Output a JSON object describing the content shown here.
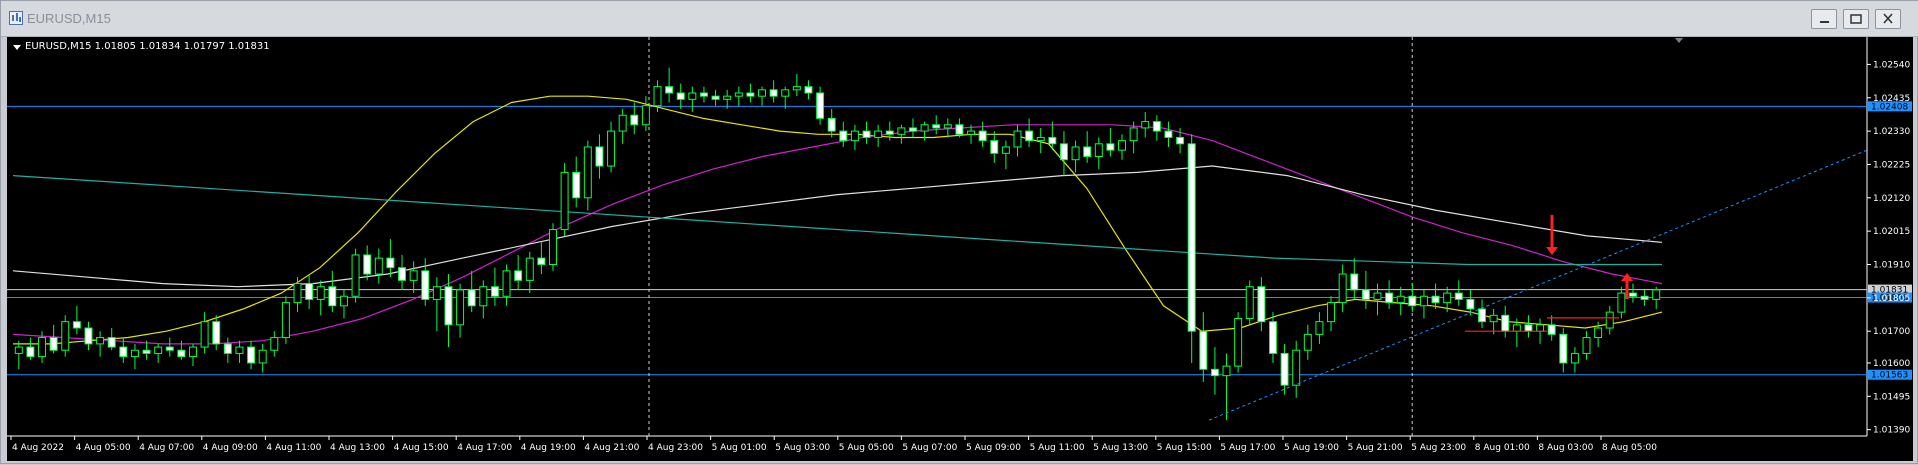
{
  "window": {
    "title": "EURUSD,M15"
  },
  "chart_data": {
    "type": "candlestick",
    "header_label": "EURUSD,M15  1.01805 1.01834 1.01797 1.01831",
    "y_ticks": [
      "1.02540",
      "1.02435",
      "1.02330",
      "1.02225",
      "1.02120",
      "1.02015",
      "1.01910",
      "1.01805",
      "1.01700",
      "1.01600",
      "1.01495",
      "1.01390"
    ],
    "x_ticks": [
      "4 Aug 2022",
      "4 Aug 05:00",
      "4 Aug 07:00",
      "4 Aug 09:00",
      "4 Aug 11:00",
      "4 Aug 13:00",
      "4 Aug 15:00",
      "4 Aug 17:00",
      "4 Aug 19:00",
      "4 Aug 21:00",
      "4 Aug 23:00",
      "5 Aug 01:00",
      "5 Aug 03:00",
      "5 Aug 05:00",
      "5 Aug 07:00",
      "5 Aug 09:00",
      "5 Aug 11:00",
      "5 Aug 13:00",
      "5 Aug 15:00",
      "5 Aug 17:00",
      "5 Aug 19:00",
      "5 Aug 21:00",
      "5 Aug 23:00",
      "8 Aug 01:00",
      "8 Aug 03:00",
      "8 Aug 05:00"
    ],
    "ylim": [
      1.0137,
      1.0262
    ],
    "horizontal_levels": [
      {
        "price": 1.02408,
        "label": "1.02408",
        "color": "#1e90ff"
      },
      {
        "price": 1.01831,
        "label": "1.01831",
        "color": "#d0d0d0"
      },
      {
        "price": 1.01806,
        "label": "1.01806",
        "color": "#1e90ff"
      },
      {
        "price": 1.01563,
        "label": "1.01563",
        "color": "#1e90ff"
      }
    ],
    "period_separators": [
      "4 Aug 23:00",
      "5 Aug 23:00"
    ],
    "candles": [
      [
        1.0163,
        1.0167,
        1.0158,
        1.0165
      ],
      [
        1.0165,
        1.0168,
        1.0161,
        1.0162
      ],
      [
        1.0162,
        1.017,
        1.016,
        1.0168
      ],
      [
        1.0168,
        1.0172,
        1.0163,
        1.0164
      ],
      [
        1.0164,
        1.0175,
        1.0162,
        1.0173
      ],
      [
        1.0173,
        1.0178,
        1.0169,
        1.0171
      ],
      [
        1.0171,
        1.0173,
        1.0164,
        1.0166
      ],
      [
        1.0166,
        1.017,
        1.0162,
        1.0168
      ],
      [
        1.0168,
        1.0171,
        1.0164,
        1.0165
      ],
      [
        1.0165,
        1.0168,
        1.016,
        1.0162
      ],
      [
        1.0162,
        1.0166,
        1.0158,
        1.0164
      ],
      [
        1.0164,
        1.0167,
        1.0161,
        1.0163
      ],
      [
        1.0163,
        1.0166,
        1.016,
        1.0165
      ],
      [
        1.0165,
        1.0168,
        1.0162,
        1.0164
      ],
      [
        1.0164,
        1.0167,
        1.0161,
        1.0162
      ],
      [
        1.0162,
        1.0166,
        1.0159,
        1.0165
      ],
      [
        1.0165,
        1.0176,
        1.0163,
        1.0173
      ],
      [
        1.0173,
        1.0175,
        1.0164,
        1.0166
      ],
      [
        1.0166,
        1.0168,
        1.016,
        1.0163
      ],
      [
        1.0163,
        1.0167,
        1.016,
        1.0165
      ],
      [
        1.0165,
        1.0167,
        1.0158,
        1.016
      ],
      [
        1.016,
        1.0166,
        1.0157,
        1.0164
      ],
      [
        1.0164,
        1.017,
        1.0162,
        1.0168
      ],
      [
        1.0168,
        1.0181,
        1.0166,
        1.0179
      ],
      [
        1.0179,
        1.0187,
        1.0176,
        1.0185
      ],
      [
        1.0185,
        1.0188,
        1.0177,
        1.018
      ],
      [
        1.018,
        1.0186,
        1.0175,
        1.0184
      ],
      [
        1.0184,
        1.0189,
        1.0176,
        1.0178
      ],
      [
        1.0178,
        1.0183,
        1.0174,
        1.0181
      ],
      [
        1.0181,
        1.0196,
        1.0179,
        1.0194
      ],
      [
        1.0194,
        1.0197,
        1.0186,
        1.0188
      ],
      [
        1.0188,
        1.0196,
        1.0185,
        1.0193
      ],
      [
        1.0193,
        1.0199,
        1.0187,
        1.019
      ],
      [
        1.019,
        1.0194,
        1.0183,
        1.0186
      ],
      [
        1.0186,
        1.0192,
        1.0182,
        1.0189
      ],
      [
        1.0189,
        1.0193,
        1.0178,
        1.018
      ],
      [
        1.018,
        1.0187,
        1.017,
        1.0184
      ],
      [
        1.0184,
        1.0188,
        1.0165,
        1.0172
      ],
      [
        1.0172,
        1.0185,
        1.0168,
        1.0183
      ],
      [
        1.0183,
        1.0189,
        1.0176,
        1.0178
      ],
      [
        1.0178,
        1.0186,
        1.0174,
        1.0184
      ],
      [
        1.0184,
        1.019,
        1.0178,
        1.0181
      ],
      [
        1.0181,
        1.0191,
        1.0178,
        1.0189
      ],
      [
        1.0189,
        1.0194,
        1.0183,
        1.0186
      ],
      [
        1.0186,
        1.0195,
        1.0182,
        1.0193
      ],
      [
        1.0193,
        1.0198,
        1.0188,
        1.0191
      ],
      [
        1.0191,
        1.0204,
        1.0189,
        1.0202
      ],
      [
        1.0202,
        1.0223,
        1.02,
        1.022
      ],
      [
        1.022,
        1.0225,
        1.0209,
        1.0212
      ],
      [
        1.0212,
        1.023,
        1.0208,
        1.0228
      ],
      [
        1.0228,
        1.0232,
        1.0218,
        1.0222
      ],
      [
        1.0222,
        1.0236,
        1.022,
        1.0233
      ],
      [
        1.0233,
        1.024,
        1.0229,
        1.0238
      ],
      [
        1.0238,
        1.0242,
        1.0232,
        1.0235
      ],
      [
        1.0235,
        1.0244,
        1.0233,
        1.0241
      ],
      [
        1.0241,
        1.0249,
        1.0239,
        1.0247
      ],
      [
        1.0247,
        1.0253,
        1.0242,
        1.0245
      ],
      [
        1.0245,
        1.0248,
        1.024,
        1.0243
      ],
      [
        1.0243,
        1.0247,
        1.0239,
        1.0245
      ],
      [
        1.0245,
        1.0247,
        1.0242,
        1.0244
      ],
      [
        1.0244,
        1.0246,
        1.0241,
        1.0243
      ],
      [
        1.0243,
        1.0246,
        1.024,
        1.0244
      ],
      [
        1.0244,
        1.0247,
        1.0241,
        1.0245
      ],
      [
        1.0245,
        1.0248,
        1.0242,
        1.0244
      ],
      [
        1.0244,
        1.0247,
        1.0241,
        1.0246
      ],
      [
        1.0246,
        1.0249,
        1.0242,
        1.0244
      ],
      [
        1.0244,
        1.0247,
        1.024,
        1.0246
      ],
      [
        1.0246,
        1.0251,
        1.0244,
        1.0247
      ],
      [
        1.0247,
        1.0249,
        1.0243,
        1.0245
      ],
      [
        1.0245,
        1.0247,
        1.0235,
        1.0237
      ],
      [
        1.0237,
        1.024,
        1.0231,
        1.0233
      ],
      [
        1.0233,
        1.0236,
        1.0228,
        1.023
      ],
      [
        1.023,
        1.0235,
        1.0227,
        1.0233
      ],
      [
        1.0233,
        1.0236,
        1.0229,
        1.0231
      ],
      [
        1.0231,
        1.0235,
        1.0228,
        1.0233
      ],
      [
        1.0233,
        1.0236,
        1.023,
        1.0232
      ],
      [
        1.0232,
        1.0235,
        1.0229,
        1.0234
      ],
      [
        1.0234,
        1.0237,
        1.0231,
        1.0233
      ],
      [
        1.0233,
        1.0236,
        1.023,
        1.0235
      ],
      [
        1.0235,
        1.0238,
        1.0232,
        1.0234
      ],
      [
        1.0234,
        1.0237,
        1.0231,
        1.0235
      ],
      [
        1.0235,
        1.0237,
        1.0231,
        1.0232
      ],
      [
        1.0232,
        1.0235,
        1.0229,
        1.0233
      ],
      [
        1.0233,
        1.0236,
        1.0228,
        1.023
      ],
      [
        1.023,
        1.0233,
        1.0223,
        1.0226
      ],
      [
        1.0226,
        1.023,
        1.0221,
        1.0228
      ],
      [
        1.0228,
        1.0235,
        1.0225,
        1.0233
      ],
      [
        1.0233,
        1.0237,
        1.0228,
        1.023
      ],
      [
        1.023,
        1.0234,
        1.0226,
        1.0231
      ],
      [
        1.0231,
        1.0236,
        1.0227,
        1.0229
      ],
      [
        1.0229,
        1.0233,
        1.0219,
        1.0224
      ],
      [
        1.0224,
        1.023,
        1.022,
        1.0228
      ],
      [
        1.0228,
        1.0233,
        1.0223,
        1.0225
      ],
      [
        1.0225,
        1.0231,
        1.0221,
        1.0229
      ],
      [
        1.0229,
        1.0234,
        1.0225,
        1.0227
      ],
      [
        1.0227,
        1.0232,
        1.0224,
        1.023
      ],
      [
        1.023,
        1.0236,
        1.0226,
        1.0234
      ],
      [
        1.0234,
        1.0239,
        1.0231,
        1.0236
      ],
      [
        1.0236,
        1.0238,
        1.023,
        1.0233
      ],
      [
        1.0233,
        1.0236,
        1.0228,
        1.0231
      ],
      [
        1.0231,
        1.0234,
        1.0226,
        1.0229
      ],
      [
        1.0229,
        1.0232,
        1.016,
        1.017
      ],
      [
        1.017,
        1.0176,
        1.0154,
        1.0158
      ],
      [
        1.0158,
        1.0165,
        1.015,
        1.0156
      ],
      [
        1.0156,
        1.0163,
        1.0142,
        1.0159
      ],
      [
        1.0159,
        1.0176,
        1.0157,
        1.0174
      ],
      [
        1.0174,
        1.0186,
        1.0172,
        1.0184
      ],
      [
        1.0184,
        1.0187,
        1.017,
        1.0173
      ],
      [
        1.0173,
        1.0176,
        1.016,
        1.0163
      ],
      [
        1.0163,
        1.0166,
        1.015,
        1.0153
      ],
      [
        1.0153,
        1.0167,
        1.0149,
        1.0164
      ],
      [
        1.0164,
        1.0172,
        1.0161,
        1.0169
      ],
      [
        1.0169,
        1.0176,
        1.0166,
        1.0173
      ],
      [
        1.0173,
        1.0181,
        1.017,
        1.0179
      ],
      [
        1.0179,
        1.0191,
        1.0176,
        1.0188
      ],
      [
        1.0188,
        1.0193,
        1.018,
        1.0183
      ],
      [
        1.0183,
        1.0189,
        1.0177,
        1.018
      ],
      [
        1.018,
        1.0185,
        1.0175,
        1.0182
      ],
      [
        1.0182,
        1.0186,
        1.0177,
        1.0179
      ],
      [
        1.0179,
        1.0184,
        1.0175,
        1.0181
      ],
      [
        1.0181,
        1.0185,
        1.0176,
        1.0178
      ],
      [
        1.0178,
        1.0183,
        1.0174,
        1.0181
      ],
      [
        1.0181,
        1.0185,
        1.0177,
        1.0179
      ],
      [
        1.0179,
        1.0184,
        1.0176,
        1.0182
      ],
      [
        1.0182,
        1.0186,
        1.0178,
        1.018
      ],
      [
        1.018,
        1.0183,
        1.0175,
        1.0177
      ],
      [
        1.0177,
        1.018,
        1.0171,
        1.0173
      ],
      [
        1.0173,
        1.0177,
        1.0169,
        1.0175
      ],
      [
        1.0175,
        1.0178,
        1.0168,
        1.017
      ],
      [
        1.017,
        1.0174,
        1.0165,
        1.0172
      ],
      [
        1.0172,
        1.0175,
        1.0168,
        1.017
      ],
      [
        1.017,
        1.0174,
        1.0166,
        1.0172
      ],
      [
        1.0172,
        1.0175,
        1.0167,
        1.0169
      ],
      [
        1.0169,
        1.0171,
        1.0157,
        1.016
      ],
      [
        1.016,
        1.0165,
        1.0157,
        1.0163
      ],
      [
        1.0163,
        1.017,
        1.0161,
        1.0168
      ],
      [
        1.0168,
        1.0173,
        1.0165,
        1.0171
      ],
      [
        1.0171,
        1.0178,
        1.0169,
        1.0176
      ],
      [
        1.0176,
        1.0184,
        1.0174,
        1.0182
      ],
      [
        1.0182,
        1.0185,
        1.0179,
        1.0181
      ],
      [
        1.0181,
        1.0183,
        1.0178,
        1.018
      ],
      [
        1.018,
        1.0184,
        1.0177,
        1.0183
      ]
    ],
    "moving_averages": [
      {
        "color": "#e6e600",
        "values": [
          1.0166,
          1.0166,
          1.0167,
          1.0168,
          1.017,
          1.0173,
          1.0177,
          1.0182,
          1.019,
          1.0201,
          1.0214,
          1.0226,
          1.0236,
          1.0242,
          1.0244,
          1.0244,
          1.0243,
          1.024,
          1.0237,
          1.0235,
          1.0233,
          1.0232,
          1.0232,
          1.0231,
          1.0231,
          1.0232,
          1.0232,
          1.0229,
          1.0215,
          1.0196,
          1.0178,
          1.017,
          1.0171,
          1.0175,
          1.0178,
          1.018,
          1.0179,
          1.0178,
          1.0176,
          1.0173,
          1.0172,
          1.0171,
          1.0173,
          1.0176
        ]
      },
      {
        "color": "#d020d0",
        "values": [
          1.0169,
          1.0168,
          1.0167,
          1.0166,
          1.0166,
          1.0167,
          1.017,
          1.0174,
          1.018,
          1.0187,
          1.0195,
          1.0203,
          1.021,
          1.0216,
          1.0221,
          1.0225,
          1.0228,
          1.0231,
          1.0233,
          1.0234,
          1.0235,
          1.0235,
          1.0235,
          1.0234,
          1.023,
          1.0224,
          1.0218,
          1.0212,
          1.0206,
          1.0201,
          1.0197,
          1.0192,
          1.0188,
          1.0185
        ]
      },
      {
        "color": "#e0e0e0",
        "values": [
          1.0189,
          1.0187,
          1.0185,
          1.0184,
          1.0185,
          1.0188,
          1.0193,
          1.0198,
          1.0203,
          1.0207,
          1.021,
          1.0213,
          1.0215,
          1.0217,
          1.0219,
          1.022,
          1.0222,
          1.0219,
          1.0213,
          1.0208,
          1.0204,
          1.02,
          1.0198
        ]
      },
      {
        "color": "#20b0a0",
        "values": [
          1.0219,
          1.0217,
          1.0215,
          1.0213,
          1.0211,
          1.0209,
          1.0207,
          1.0205,
          1.0203,
          1.0201,
          1.0199,
          1.0197,
          1.0195,
          1.0193,
          1.0192,
          1.0191,
          1.0191,
          1.0191
        ]
      }
    ],
    "trendline": {
      "color": "#1e90ff",
      "style": "dashed",
      "from": [
        "5 Aug 15:00",
        1.0142
      ],
      "to": [
        "8 Aug 05:00+",
        1.0227
      ]
    },
    "arrows": [
      {
        "direction": "down",
        "color": "#ff2020"
      },
      {
        "direction": "up",
        "color": "#ff2020"
      }
    ]
  }
}
